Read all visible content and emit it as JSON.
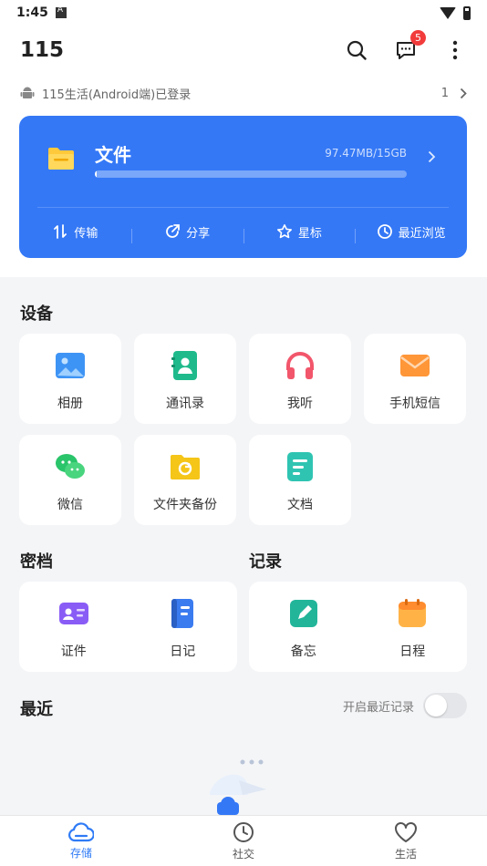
{
  "status": {
    "time": "1:45"
  },
  "header": {
    "title": "115",
    "message_badge": "5"
  },
  "login": {
    "text": "115生活(Android端)已登录",
    "count": "1"
  },
  "file_card": {
    "name": "文件",
    "usage": "97.47MB/15GB",
    "usage_fraction": 0.006,
    "quick": [
      {
        "label": "传输",
        "icon": "transfer-icon"
      },
      {
        "label": "分享",
        "icon": "share-icon"
      },
      {
        "label": "星标",
        "icon": "star-icon"
      },
      {
        "label": "最近浏览",
        "icon": "history-icon"
      }
    ]
  },
  "devices": {
    "title": "设备",
    "items": [
      {
        "label": "相册",
        "icon": "photo-album-icon"
      },
      {
        "label": "通讯录",
        "icon": "contacts-icon"
      },
      {
        "label": "我听",
        "icon": "headphones-icon"
      },
      {
        "label": "手机短信",
        "icon": "sms-icon"
      },
      {
        "label": "微信",
        "icon": "wechat-icon"
      },
      {
        "label": "文件夹备份",
        "icon": "folder-backup-icon"
      },
      {
        "label": "文档",
        "icon": "document-icon"
      }
    ]
  },
  "vault": {
    "title": "密档",
    "items": [
      {
        "label": "证件",
        "icon": "id-card-icon"
      },
      {
        "label": "日记",
        "icon": "diary-icon"
      }
    ]
  },
  "records": {
    "title": "记录",
    "items": [
      {
        "label": "备忘",
        "icon": "memo-icon"
      },
      {
        "label": "日程",
        "icon": "calendar-icon"
      }
    ]
  },
  "recent": {
    "title": "最近",
    "toggle_label": "开启最近记录",
    "toggle_on": false
  },
  "tabs": [
    {
      "label": "存储",
      "icon": "cloud-icon",
      "active": true
    },
    {
      "label": "社交",
      "icon": "clock-icon",
      "active": false
    },
    {
      "label": "生活",
      "icon": "heart-icon",
      "active": false
    }
  ],
  "colors": {
    "accent": "#3478f6",
    "tab_active": "#2f7bf6",
    "badge": "#f23b3b"
  }
}
